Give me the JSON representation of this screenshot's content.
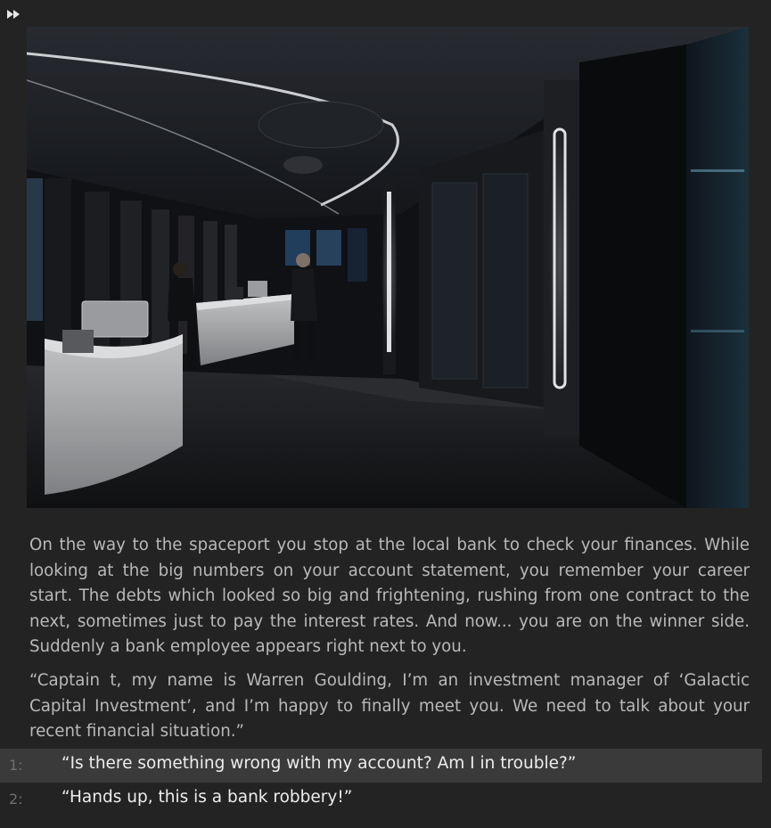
{
  "controls": {
    "skip_icon": "fast-forward-icon"
  },
  "scene": {
    "image": "bank-interior-illustration"
  },
  "narration": [
    "On the way to the spaceport you stop at the local bank to check your finances. While looking at the big numbers on your account statement, you remember your career start. The debts which looked so big and frightening, rushing from one contract to the next, sometimes just to pay the interest rates. And now... you are on the winner side. Suddenly a bank employee appears right next to you.",
    "“Captain t, my name is Warren Goulding, I’m an investment manager of ‘Galactic Capital Investment’, and I’m happy to finally meet you. We need to talk about your recent financial situation.”"
  ],
  "choices": [
    {
      "number": "1:",
      "text": "“Is there something wrong with my account? Am I in trouble?”"
    },
    {
      "number": "2:",
      "text": "“Hands up, this is a bank robbery!”"
    }
  ]
}
